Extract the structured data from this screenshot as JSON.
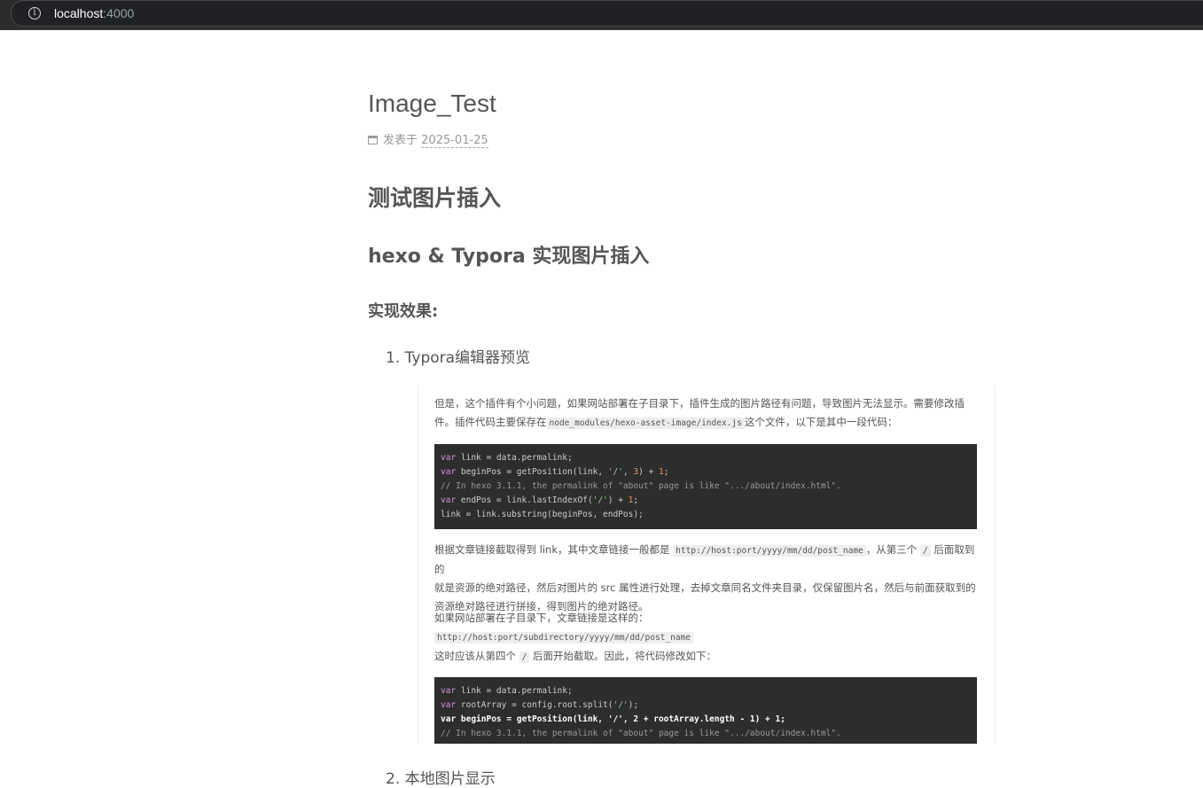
{
  "browser": {
    "url_host": "localhost",
    "url_port": ":4000"
  },
  "post": {
    "title": "Image_Test",
    "meta_prefix": "发表于",
    "date": "2025-01-25",
    "h1": "测试图片插入",
    "h2": "hexo & Typora 实现图片插入",
    "h3": "实现效果:",
    "list": [
      {
        "marker": "1.",
        "text": "Typora编辑器预览"
      },
      {
        "marker": "2.",
        "text": "本地图片显示"
      }
    ]
  },
  "embedded": {
    "p1_a": "但是，这个插件有个小问题，如果网站部署在子目录下，插件生成的图片路径有问题，导致图片无法显示。需要修改插",
    "p1_b": "件。插件代码主要保存在",
    "p1_code": "node_modules/hexo-asset-image/index.js",
    "p1_c": "这个文件，以下是其中一段代码：",
    "code1": [
      {
        "kw": "var",
        "rest": " link = data.permalink;"
      },
      {
        "kw": "var",
        "rest": " beginPos = getPosition(link, ",
        "str": "'/'",
        "rest2": ", ",
        "num": "3",
        "rest3": ") + ",
        "num2": "1",
        "rest4": ";"
      },
      {
        "comment": "// In hexo 3.1.1, the permalink of \"about\" page is like \".../about/index.html\"."
      },
      {
        "kw": "var",
        "rest": " endPos = link.lastIndexOf(",
        "str": "'/'",
        "rest2": ") + ",
        "num": "1",
        "rest3": ";"
      },
      {
        "plain": "link = link.substring(beginPos, endPos);"
      }
    ],
    "p2_a": "根据文章链接截取得到 link，其中文章链接一般都是",
    "p2_code1": "http://host:port/yyyy/mm/dd/post_name",
    "p2_b": "，从第三个",
    "p2_code2": "/",
    "p2_c": "后面取到的",
    "p2_line2": "就是资源的绝对路径，然后对图片的 src 属性进行处理，去掉文章同名文件夹目录，仅保留图片名，然后与前面获取到的",
    "p2_line3": "资源绝对路径进行拼接，得到图片的绝对路径。",
    "p3_line1": "如果网站部署在子目录下，文章链接是这样的：",
    "p3_code": "http://host:port/subdirectory/yyyy/mm/dd/post_name",
    "p3_a": "这时应该从第四个",
    "p3_code2": "/",
    "p3_b": "后面开始截取。因此，将代码修改如下：",
    "code2": [
      {
        "kw": "var",
        "rest": " link = data.permalink;"
      },
      {
        "kw": "var",
        "rest": " rootArray = config.root.split(",
        "str": "'/'",
        "rest2": ");"
      },
      {
        "bold": "var beginPos = getPosition(link, '/', 2 + rootArray.length - 1) + 1;"
      },
      {
        "comment": "// In hexo 3.1.1, the permalink of \"about\" page is like \".../about/index.html\"."
      }
    ]
  }
}
